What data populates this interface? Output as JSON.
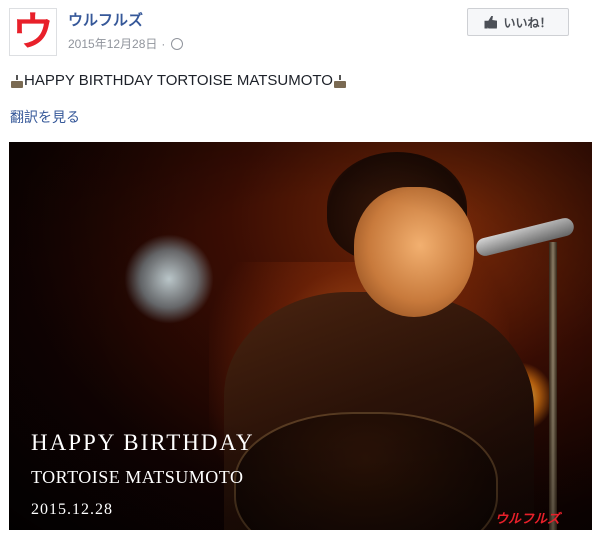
{
  "post": {
    "page_name": "ウルフルズ",
    "avatar_glyph": "ウ",
    "date": "2015年12月28日",
    "separator": "·",
    "privacy_icon": "globe-icon",
    "text": "HAPPY BIRTHDAY TORTOISE MATSUMOTO",
    "see_translation": "翻訳を見る"
  },
  "like_button": {
    "label": "いいね！",
    "icon": "thumbs-up-icon"
  },
  "photo": {
    "line1": "HAPPY BIRTHDAY",
    "line2": "TORTOISE MATSUMOTO",
    "line3": "2015.12.28",
    "watermark": "ウルフルズ"
  },
  "colors": {
    "link": "#365899",
    "brand_red": "#e8202a",
    "meta": "#90949c"
  }
}
